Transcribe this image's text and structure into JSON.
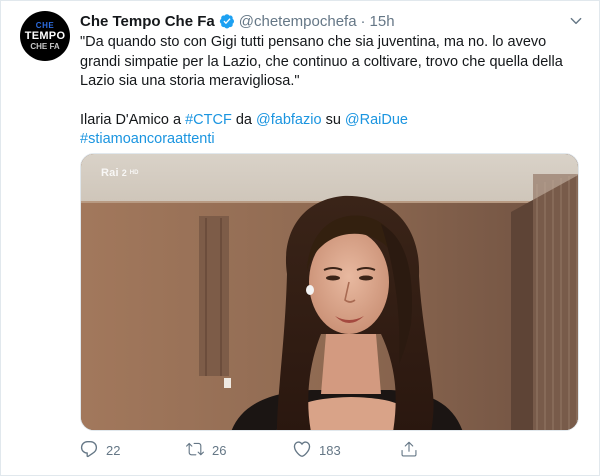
{
  "author": {
    "display_name": "Che Tempo Che Fa",
    "handle": "@chetempochefa",
    "time": "15h",
    "avatar_lines": [
      "CHE",
      "TEMPO",
      "CHE FA"
    ]
  },
  "tweet": {
    "quote": "\"Da quando sto con Gigi tutti pensano che sia juventina, ma no. lo avevo grandi simpatie per la Lazio, che continuo a coltivare, trovo che quella della Lazio sia una storia meravigliosa.\"",
    "line2_prefix": "Ilaria D'Amico a ",
    "hashtag_ctcf": "#CTCF",
    "line2_da": " da ",
    "mention_fabfazio": "@fabfazio",
    "line2_su": " su ",
    "mention_raidue": "@RaiDue",
    "hashtag_stiamo": "#stiamoancoraattenti"
  },
  "media": {
    "logo_rai": "Rai",
    "logo_channel": "2",
    "logo_hd": "HD"
  },
  "actions": {
    "reply_count": "22",
    "retweet_count": "26",
    "like_count": "183"
  },
  "colors": {
    "link": "#1b95e0",
    "verified": "#1da1f2",
    "muted": "#657786"
  }
}
